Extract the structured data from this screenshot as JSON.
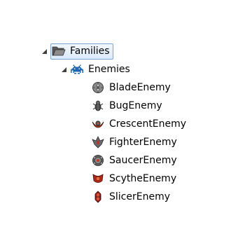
{
  "tree": {
    "root": {
      "label": "Families",
      "icon": "folder-open-icon",
      "expanded": true,
      "selected": true
    },
    "group": {
      "label": "Enemies",
      "icon": "invader-icon",
      "expanded": true
    },
    "items": [
      {
        "label": "BladeEnemy",
        "icon": "blade-enemy-icon"
      },
      {
        "label": "BugEnemy",
        "icon": "bug-enemy-icon"
      },
      {
        "label": "CrescentEnemy",
        "icon": "crescent-enemy-icon"
      },
      {
        "label": "FighterEnemy",
        "icon": "fighter-enemy-icon"
      },
      {
        "label": "SaucerEnemy",
        "icon": "saucer-enemy-icon"
      },
      {
        "label": "ScytheEnemy",
        "icon": "scythe-enemy-icon"
      },
      {
        "label": "SlicerEnemy",
        "icon": "slicer-enemy-icon"
      }
    ]
  },
  "colors": {
    "selection_border": "#7da2ce",
    "selection_fill": "#dcebfc",
    "expander": "#404040",
    "invader": "#1f66b3",
    "folder": "#3c3c3c"
  }
}
